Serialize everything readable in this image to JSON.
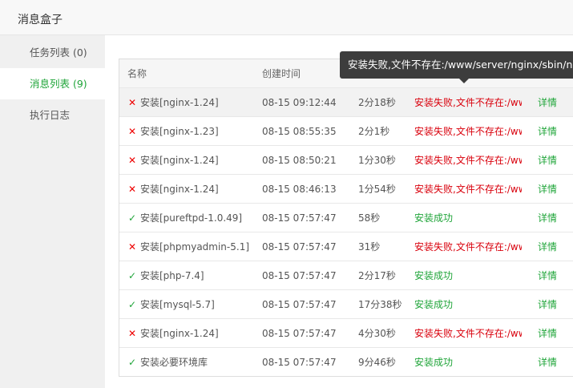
{
  "window": {
    "title": "消息盒子"
  },
  "sidebar": {
    "items": [
      {
        "label": "任务列表 (0)"
      },
      {
        "label": "消息列表 (9)"
      },
      {
        "label": "执行日志"
      }
    ]
  },
  "tooltip": {
    "text": "安装失败,文件不存在:/www/server/nginx/sbin/nginx"
  },
  "table": {
    "headers": [
      "名称",
      "创建时间",
      "",
      "",
      ""
    ],
    "action_label": "详情",
    "rows": [
      {
        "status_type": "fail",
        "name": "安装[nginx-1.24]",
        "time": "08-15 09:12:44",
        "duration": "2分18秒",
        "status": "安装失败,文件不存在:/www/server/nginx/sbin/nginx"
      },
      {
        "status_type": "fail",
        "name": "安装[nginx-1.23]",
        "time": "08-15 08:55:35",
        "duration": "2分1秒",
        "status": "安装失败,文件不存在:/www/server/nginx/sbin/nginx"
      },
      {
        "status_type": "fail",
        "name": "安装[nginx-1.24]",
        "time": "08-15 08:50:21",
        "duration": "1分30秒",
        "status": "安装失败,文件不存在:/www/server/nginx/sbin/nginx"
      },
      {
        "status_type": "fail",
        "name": "安装[nginx-1.24]",
        "time": "08-15 08:46:13",
        "duration": "1分54秒",
        "status": "安装失败,文件不存在:/www/server/nginx/sbin/nginx"
      },
      {
        "status_type": "ok",
        "name": "安装[pureftpd-1.0.49]",
        "time": "08-15 07:57:47",
        "duration": "58秒",
        "status": "安装成功"
      },
      {
        "status_type": "fail",
        "name": "安装[phpmyadmin-5.1]",
        "time": "08-15 07:57:47",
        "duration": "31秒",
        "status": "安装失败,文件不存在:/www/server/nginx/sbin/nginx"
      },
      {
        "status_type": "ok",
        "name": "安装[php-7.4]",
        "time": "08-15 07:57:47",
        "duration": "2分17秒",
        "status": "安装成功"
      },
      {
        "status_type": "ok",
        "name": "安装[mysql-5.7]",
        "time": "08-15 07:57:47",
        "duration": "17分38秒",
        "status": "安装成功"
      },
      {
        "status_type": "fail",
        "name": "安装[nginx-1.24]",
        "time": "08-15 07:57:47",
        "duration": "4分30秒",
        "status": "安装失败,文件不存在:/www/server/nginx/sbin/nginx"
      },
      {
        "status_type": "ok",
        "name": "安装必要环境库",
        "time": "08-15 07:57:47",
        "duration": "9分46秒",
        "status": "安装成功"
      }
    ]
  }
}
